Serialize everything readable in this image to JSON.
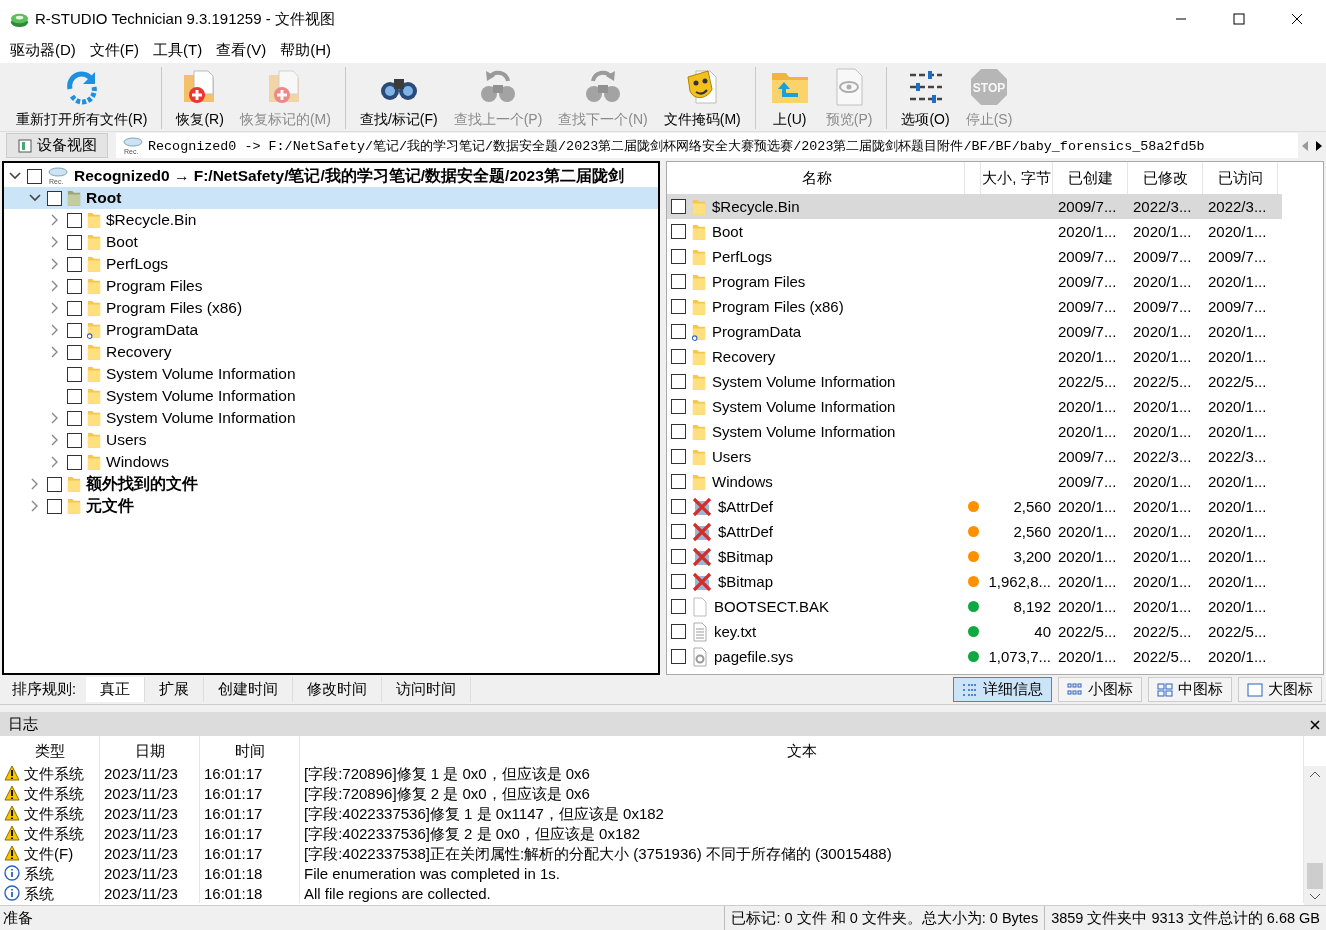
{
  "window": {
    "title": "R-STUDIO Technician 9.3.191259 - 文件视图"
  },
  "menu": [
    "驱动器(D)",
    "文件(F)",
    "工具(T)",
    "查看(V)",
    "帮助(H)"
  ],
  "toolbar": [
    {
      "label": "重新打开所有文件(R)",
      "disabled": false,
      "separator_after": true
    },
    {
      "label": "恢复(R)",
      "disabled": false,
      "separator_after": false
    },
    {
      "label": "恢复标记的(M)",
      "disabled": true,
      "separator_after": true
    },
    {
      "label": "查找/标记(F)",
      "disabled": false,
      "separator_after": false
    },
    {
      "label": "查找上一个(P)",
      "disabled": true,
      "separator_after": false
    },
    {
      "label": "查找下一个(N)",
      "disabled": true,
      "separator_after": false
    },
    {
      "label": "文件掩码(M)",
      "disabled": false,
      "separator_after": true
    },
    {
      "label": "上(U)",
      "disabled": false,
      "separator_after": false
    },
    {
      "label": "预览(P)",
      "disabled": true,
      "separator_after": true
    },
    {
      "label": "选项(O)",
      "disabled": false,
      "separator_after": false
    },
    {
      "label": "停止(S)",
      "disabled": true,
      "separator_after": false,
      "icon_text": "STOP"
    }
  ],
  "path_bar": {
    "tab": "设备视图",
    "icon_text": "Rec.",
    "path": "Recognized0 -> F:/NetSafety/笔记/我的学习笔记/数据安全题/2023第二届陇剑杯网络安全大赛预选赛/2023第二届陇剑杯题目附件/BF/BF/baby_forensics_58a2fd5b"
  },
  "tree": [
    {
      "label": "Recognized0 → F:/NetSafety/笔记/我的学习笔记/数据安全题/2023第二届陇剑",
      "kind": "drive",
      "icon_text": "Rec.",
      "checked": false,
      "selected": false,
      "expandable": true,
      "expanded": true,
      "children": [
        {
          "label": "Root",
          "kind": "root",
          "checked": false,
          "selected": true,
          "expandable": true,
          "expanded": true,
          "children": [
            {
              "label": "$Recycle.Bin",
              "kind": "folder",
              "checked": false,
              "selected": false,
              "expandable": true,
              "expanded": false
            },
            {
              "label": "Boot",
              "kind": "folder",
              "checked": false,
              "selected": false,
              "expandable": true,
              "expanded": false
            },
            {
              "label": "PerfLogs",
              "kind": "folder",
              "checked": false,
              "selected": false,
              "expandable": true,
              "expanded": false
            },
            {
              "label": "Program Files",
              "kind": "folder",
              "checked": false,
              "selected": false,
              "expandable": true,
              "expanded": false
            },
            {
              "label": "Program Files (x86)",
              "kind": "folder",
              "checked": false,
              "selected": false,
              "expandable": true,
              "expanded": false
            },
            {
              "label": "ProgramData",
              "kind": "folder-badge",
              "checked": false,
              "selected": false,
              "expandable": true,
              "expanded": false
            },
            {
              "label": "Recovery",
              "kind": "folder",
              "checked": false,
              "selected": false,
              "expandable": true,
              "expanded": false
            },
            {
              "label": "System Volume Information",
              "kind": "folder",
              "checked": false,
              "selected": false,
              "expandable": false
            },
            {
              "label": "System Volume Information",
              "kind": "folder",
              "checked": false,
              "selected": false,
              "expandable": false
            },
            {
              "label": "System Volume Information",
              "kind": "folder",
              "checked": false,
              "selected": false,
              "expandable": true,
              "expanded": false
            },
            {
              "label": "Users",
              "kind": "folder",
              "checked": false,
              "selected": false,
              "expandable": true,
              "expanded": false
            },
            {
              "label": "Windows",
              "kind": "folder",
              "checked": false,
              "selected": false,
              "expandable": true,
              "expanded": false
            }
          ]
        },
        {
          "label": "额外找到的文件",
          "kind": "folder",
          "checked": false,
          "selected": false,
          "expandable": true,
          "expanded": false
        },
        {
          "label": "元文件",
          "kind": "folder",
          "checked": false,
          "selected": false,
          "expandable": true,
          "expanded": false
        }
      ]
    }
  ],
  "file_list": {
    "columns": [
      "名称",
      "大小, 字节",
      "已创建",
      "已修改",
      "已访问"
    ],
    "rows": [
      {
        "name": "$Recycle.Bin",
        "kind": "folder",
        "checked": false,
        "selected": true,
        "size": "",
        "created": "2009/7...",
        "modified": "2022/3...",
        "accessed": "2022/3..."
      },
      {
        "name": "Boot",
        "kind": "folder",
        "checked": false,
        "selected": false,
        "size": "",
        "created": "2020/1...",
        "modified": "2020/1...",
        "accessed": "2020/1..."
      },
      {
        "name": "PerfLogs",
        "kind": "folder",
        "checked": false,
        "selected": false,
        "size": "",
        "created": "2009/7...",
        "modified": "2009/7...",
        "accessed": "2009/7..."
      },
      {
        "name": "Program Files",
        "kind": "folder",
        "checked": false,
        "selected": false,
        "size": "",
        "created": "2009/7...",
        "modified": "2020/1...",
        "accessed": "2020/1..."
      },
      {
        "name": "Program Files (x86)",
        "kind": "folder",
        "checked": false,
        "selected": false,
        "size": "",
        "created": "2009/7...",
        "modified": "2009/7...",
        "accessed": "2009/7..."
      },
      {
        "name": "ProgramData",
        "kind": "folder-badge",
        "checked": false,
        "selected": false,
        "size": "",
        "created": "2009/7...",
        "modified": "2020/1...",
        "accessed": "2020/1..."
      },
      {
        "name": "Recovery",
        "kind": "folder",
        "checked": false,
        "selected": false,
        "size": "",
        "created": "2020/1...",
        "modified": "2020/1...",
        "accessed": "2020/1..."
      },
      {
        "name": "System Volume Information",
        "kind": "folder",
        "checked": false,
        "selected": false,
        "size": "",
        "created": "2022/5...",
        "modified": "2022/5...",
        "accessed": "2022/5..."
      },
      {
        "name": "System Volume Information",
        "kind": "folder",
        "checked": false,
        "selected": false,
        "size": "",
        "created": "2020/1...",
        "modified": "2020/1...",
        "accessed": "2020/1..."
      },
      {
        "name": "System Volume Information",
        "kind": "folder",
        "checked": false,
        "selected": false,
        "size": "",
        "created": "2020/1...",
        "modified": "2020/1...",
        "accessed": "2020/1..."
      },
      {
        "name": "Users",
        "kind": "folder",
        "checked": false,
        "selected": false,
        "size": "",
        "created": "2009/7...",
        "modified": "2022/3...",
        "accessed": "2022/3..."
      },
      {
        "name": "Windows",
        "kind": "folder",
        "checked": false,
        "selected": false,
        "size": "",
        "created": "2009/7...",
        "modified": "2020/1...",
        "accessed": "2020/1..."
      },
      {
        "name": "$AttrDef",
        "kind": "deleted",
        "checked": false,
        "selected": false,
        "color": "#ff9000",
        "size": "2,560",
        "created": "2020/1...",
        "modified": "2020/1...",
        "accessed": "2020/1..."
      },
      {
        "name": "$AttrDef",
        "kind": "deleted",
        "checked": false,
        "selected": false,
        "color": "#ff9000",
        "size": "2,560",
        "created": "2020/1...",
        "modified": "2020/1...",
        "accessed": "2020/1..."
      },
      {
        "name": "$Bitmap",
        "kind": "deleted",
        "checked": false,
        "selected": false,
        "color": "#ff9000",
        "size": "3,200",
        "created": "2020/1...",
        "modified": "2020/1...",
        "accessed": "2020/1..."
      },
      {
        "name": "$Bitmap",
        "kind": "deleted",
        "checked": false,
        "selected": false,
        "color": "#ff9000",
        "size": "1,962,8...",
        "created": "2020/1...",
        "modified": "2020/1...",
        "accessed": "2020/1..."
      },
      {
        "name": "BOOTSECT.BAK",
        "kind": "file",
        "checked": false,
        "selected": false,
        "color": "#10a840",
        "size": "8,192",
        "created": "2020/1...",
        "modified": "2020/1...",
        "accessed": "2020/1..."
      },
      {
        "name": "key.txt",
        "kind": "text",
        "checked": false,
        "selected": false,
        "color": "#10a840",
        "size": "40",
        "created": "2022/5...",
        "modified": "2022/5...",
        "accessed": "2022/5..."
      },
      {
        "name": "pagefile.sys",
        "kind": "system",
        "checked": false,
        "selected": false,
        "color": "#10a840",
        "size": "1,073,7...",
        "created": "2020/1...",
        "modified": "2022/5...",
        "accessed": "2020/1..."
      }
    ]
  },
  "sort_bar": {
    "label": "排序规则:",
    "tabs": [
      {
        "label": "真正",
        "selected": true
      },
      {
        "label": "扩展",
        "selected": false
      },
      {
        "label": "创建时间",
        "selected": false
      },
      {
        "label": "修改时间",
        "selected": false
      },
      {
        "label": "访问时间",
        "selected": false
      }
    ]
  },
  "view_buttons": [
    {
      "label": "详细信息",
      "selected": true
    },
    {
      "label": "小图标",
      "selected": false
    },
    {
      "label": "中图标",
      "selected": false
    },
    {
      "label": "大图标",
      "selected": false
    }
  ],
  "log": {
    "title": "日志",
    "columns": [
      "类型",
      "日期",
      "时间",
      "文本"
    ],
    "rows": [
      {
        "kind": "warning",
        "type": "文件系统",
        "date": "2023/11/23",
        "time": "16:01:17",
        "text": "[字段:720896]修复 1 是 0x0，但应该是 0x6"
      },
      {
        "kind": "warning",
        "type": "文件系统",
        "date": "2023/11/23",
        "time": "16:01:17",
        "text": "[字段:720896]修复 2 是 0x0，但应该是 0x6"
      },
      {
        "kind": "warning",
        "type": "文件系统",
        "date": "2023/11/23",
        "time": "16:01:17",
        "text": "[字段:4022337536]修复 1 是 0x1147，但应该是 0x182"
      },
      {
        "kind": "warning",
        "type": "文件系统",
        "date": "2023/11/23",
        "time": "16:01:17",
        "text": "[字段:4022337536]修复 2 是 0x0，但应该是 0x182"
      },
      {
        "kind": "warning",
        "type": "文件(F)",
        "date": "2023/11/23",
        "time": "16:01:17",
        "text": "[字段:4022337538]正在关闭属性:解析的分配大小 (3751936) 不同于所存储的 (30015488)"
      },
      {
        "kind": "info",
        "type": "系统",
        "date": "2023/11/23",
        "time": "16:01:18",
        "text": "File enumeration was completed in 1s."
      },
      {
        "kind": "info",
        "type": "系统",
        "date": "2023/11/23",
        "time": "16:01:18",
        "text": "All file regions are collected."
      }
    ]
  },
  "status_bar": [
    "准备",
    "已标记:  0 文件 和 0 文件夹。总大小为: 0 Bytes",
    "3859 文件夹中 9313 文件总计的 6.68 GB"
  ]
}
